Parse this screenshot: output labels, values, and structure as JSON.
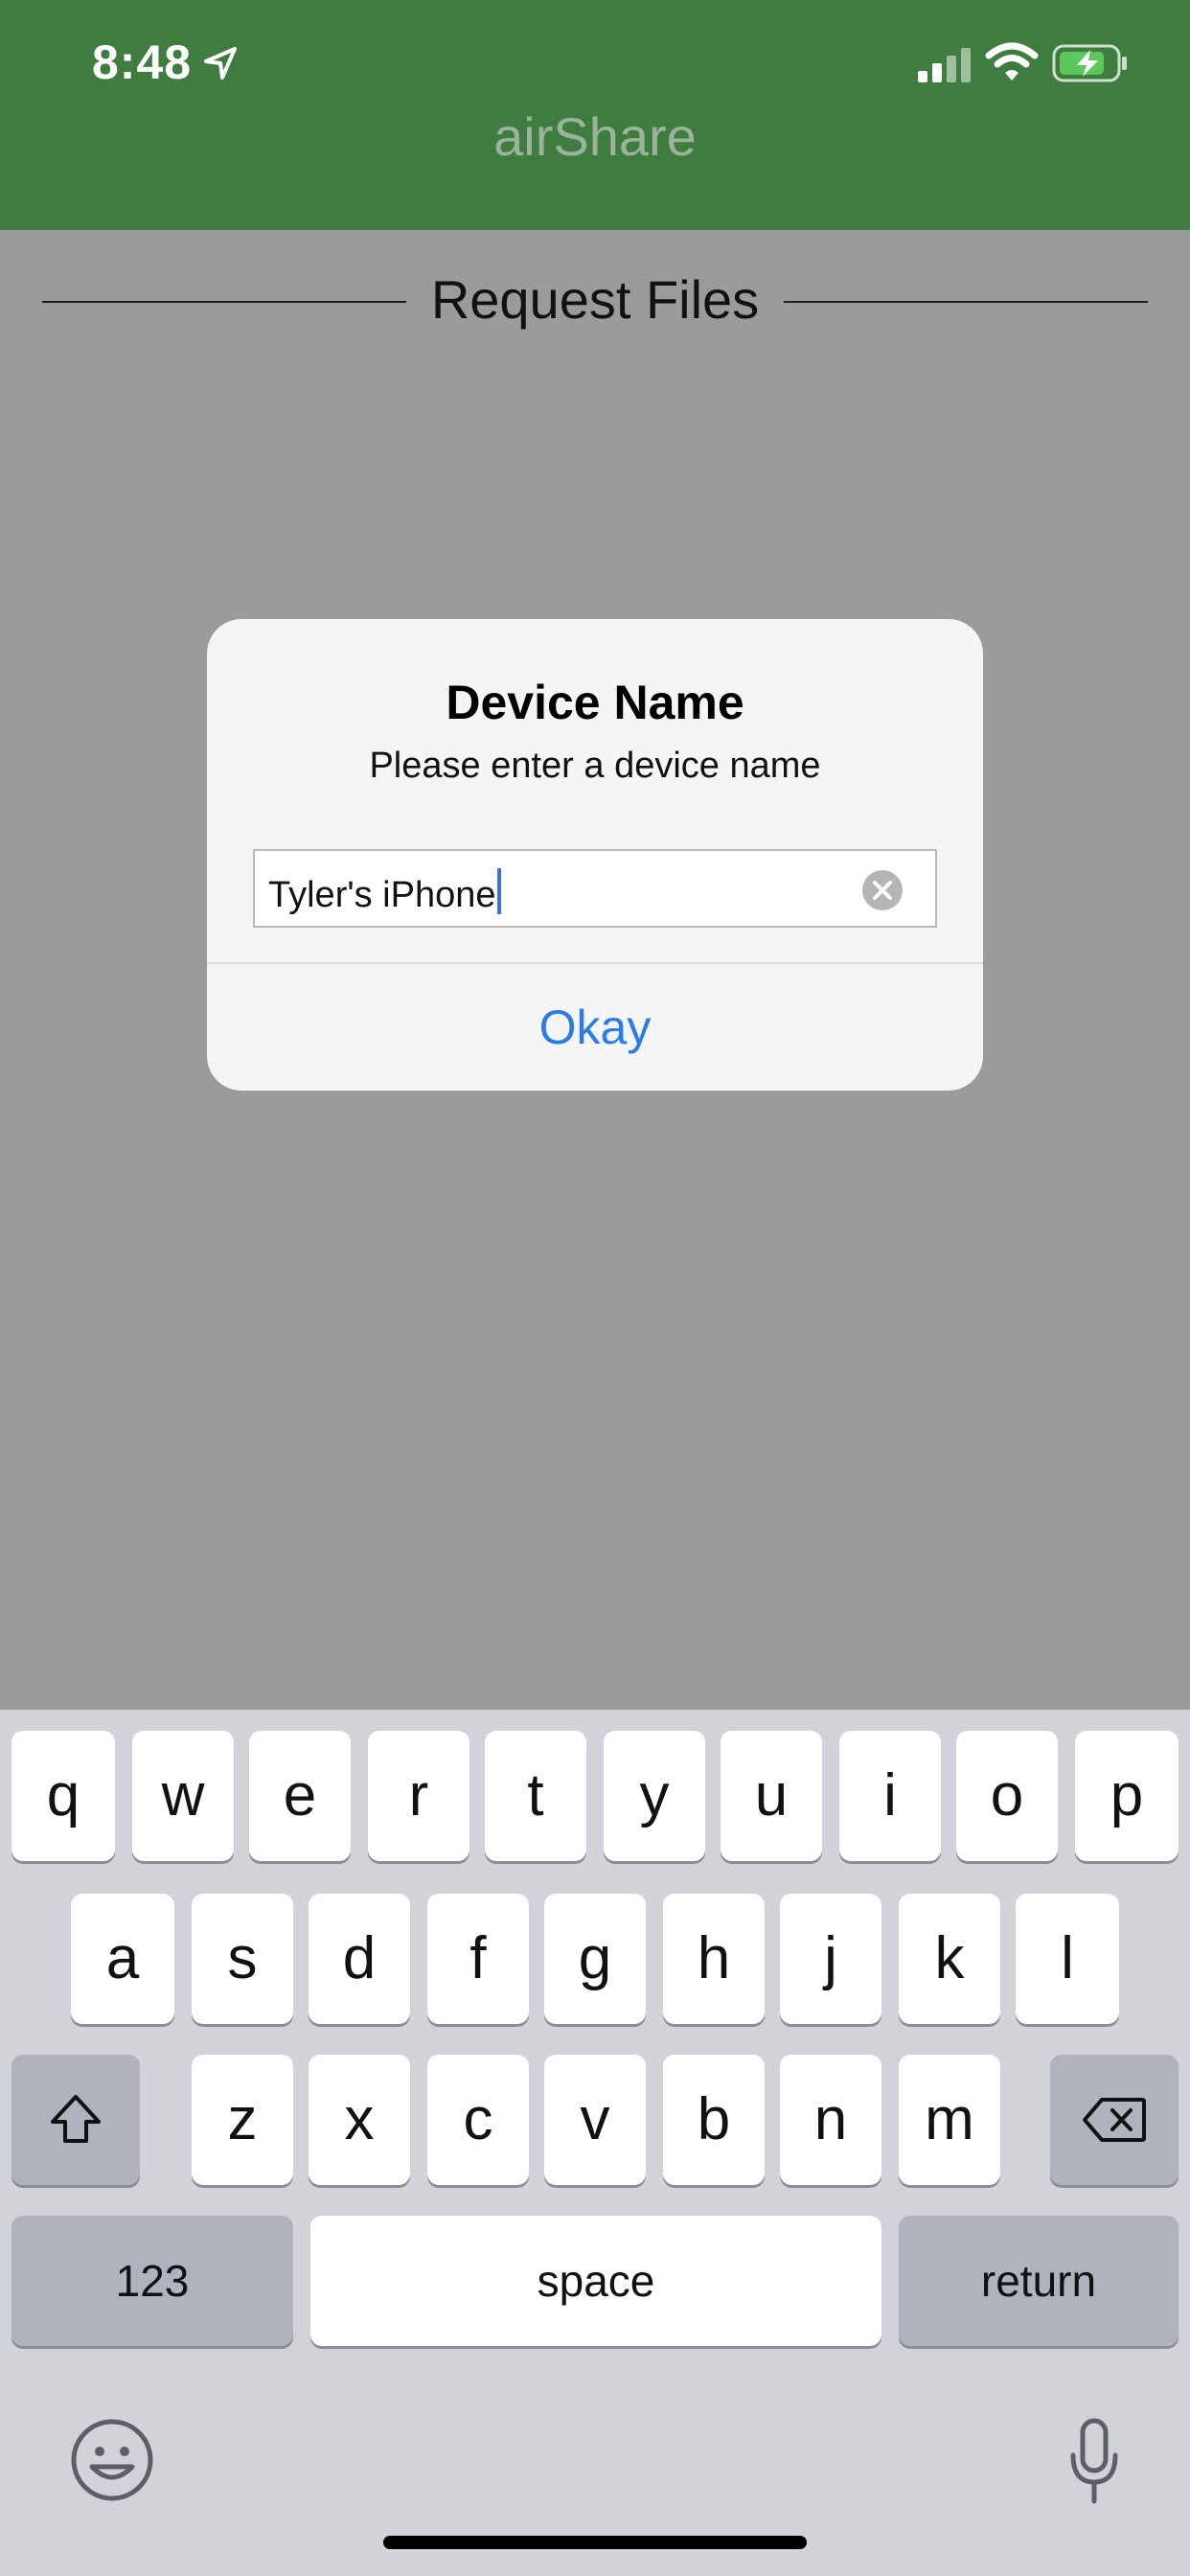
{
  "status_bar": {
    "time": "8:48",
    "icons": [
      "location-arrow-icon",
      "cellular-signal-icon",
      "wifi-icon",
      "battery-charging-icon"
    ]
  },
  "header": {
    "title": "airShare",
    "background": "#3e7d3f"
  },
  "section": {
    "title": "Request Files"
  },
  "dialog": {
    "title": "Device Name",
    "message": "Please enter a device name",
    "field_value": "Tyler's iPhone",
    "button_label": "Okay",
    "accent": "#2d7be5"
  },
  "keyboard": {
    "row1": [
      "q",
      "w",
      "e",
      "r",
      "t",
      "y",
      "u",
      "i",
      "o",
      "p"
    ],
    "row2": [
      "a",
      "s",
      "d",
      "f",
      "g",
      "h",
      "j",
      "k",
      "l"
    ],
    "row3": [
      "z",
      "x",
      "c",
      "v",
      "b",
      "n",
      "m"
    ],
    "numbers_label": "123",
    "space_label": "space",
    "return_label": "return",
    "icons": [
      "shift-icon",
      "backspace-icon",
      "emoji-icon",
      "microphone-icon"
    ]
  }
}
